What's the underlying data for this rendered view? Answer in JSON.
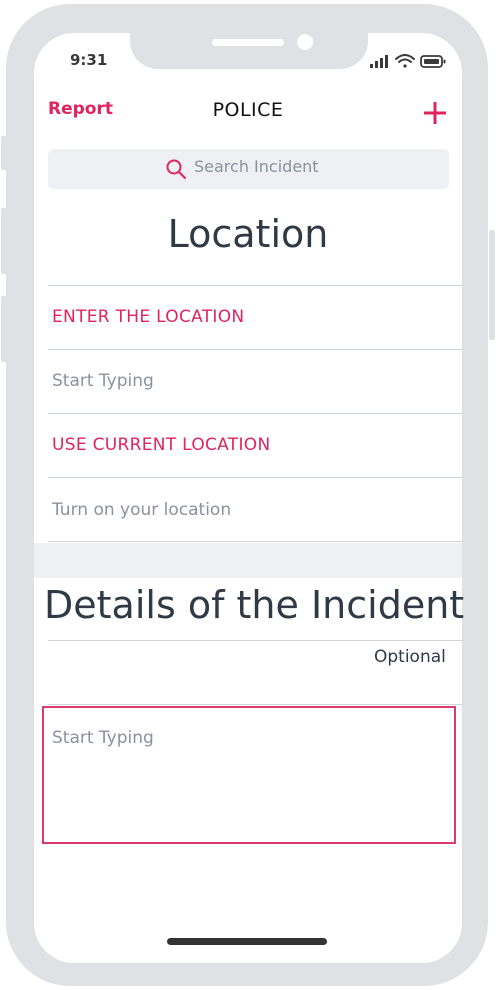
{
  "status": {
    "time": "9:31"
  },
  "nav": {
    "left": "Report",
    "title": "POLICE",
    "right_icon": "plus-icon"
  },
  "search": {
    "placeholder": "Search Incident"
  },
  "location": {
    "heading": "Location",
    "enter_label": "ENTER THE LOCATION",
    "enter_placeholder": "Start Typing",
    "current_label": "USE CURRENT LOCATION",
    "current_hint": "Turn on your location"
  },
  "details": {
    "heading": "Details of the Incident",
    "optional": "Optional",
    "placeholder": "Start Typing"
  },
  "colors": {
    "accent": "#e0245e",
    "frame": "#dfe1e4",
    "text": "#2f3a45",
    "muted": "#8a929f"
  }
}
